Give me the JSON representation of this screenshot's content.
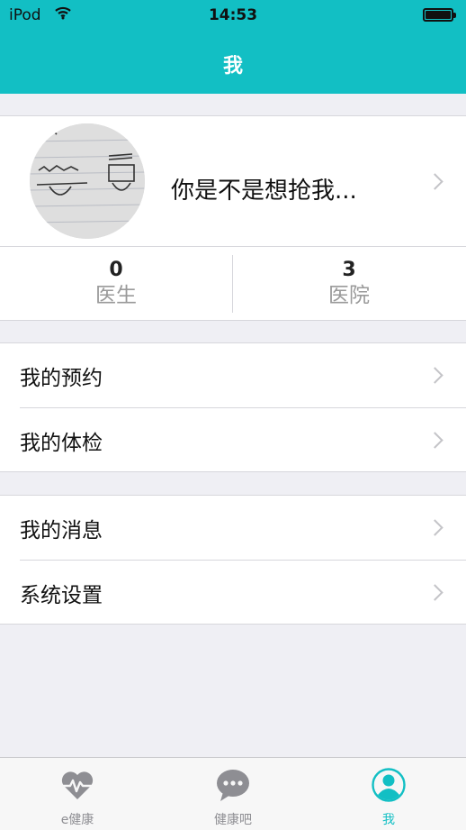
{
  "status_bar": {
    "carrier": "iPod",
    "time": "14:53"
  },
  "nav": {
    "title": "我"
  },
  "profile": {
    "name": "你是不是想抢我...",
    "stats": [
      {
        "value": "0",
        "label": "医生"
      },
      {
        "value": "3",
        "label": "医院"
      }
    ]
  },
  "menu_group_1": [
    {
      "label": "我的预约"
    },
    {
      "label": "我的体检"
    }
  ],
  "menu_group_2": [
    {
      "label": "我的消息"
    },
    {
      "label": "系统设置"
    }
  ],
  "tabbar": {
    "items": [
      {
        "label": "e健康",
        "icon": "heart-pulse-icon"
      },
      {
        "label": "健康吧",
        "icon": "chat-bubble-icon"
      },
      {
        "label": "我",
        "icon": "user-icon"
      }
    ],
    "active_index": 2
  },
  "colors": {
    "accent": "#12bfc4",
    "background": "#efeff4",
    "inactive": "#8e8e93"
  }
}
